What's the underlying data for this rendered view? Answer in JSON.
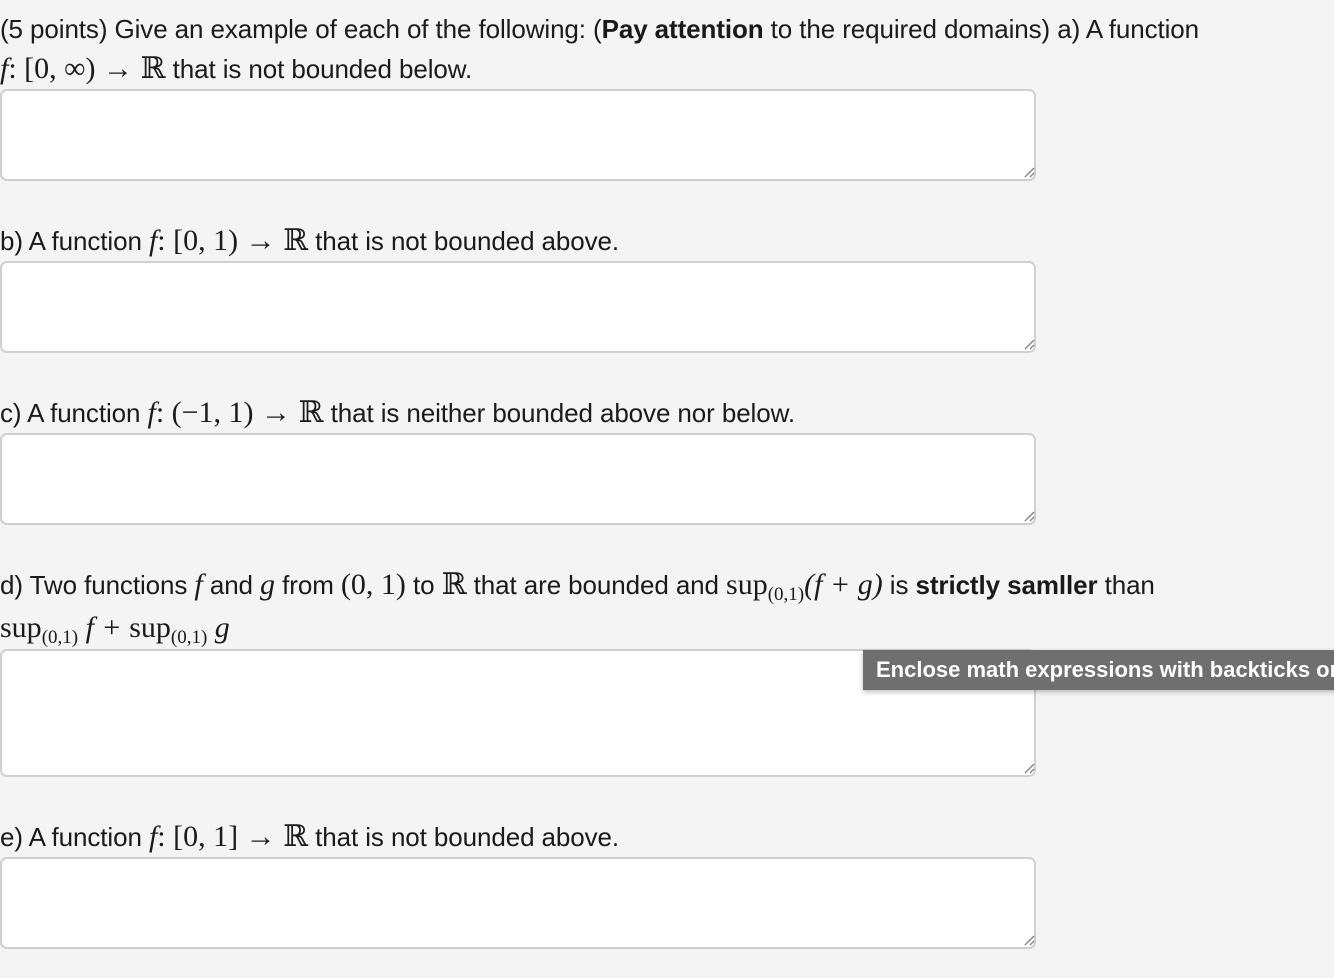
{
  "question_a": {
    "prefix": "(5 points) Give an example of each of the following: (",
    "bold": "Pay attention",
    "suffix": " to the required domains) a) A function",
    "math_f": "f",
    "math_domain": ": [0, ∞) → ℝ",
    "tail": " that is not bounded below."
  },
  "question_b": {
    "prefix": "b) A function ",
    "math_f": "f",
    "math_domain": ": [0, 1) → ℝ",
    "tail": " that is not bounded above."
  },
  "question_c": {
    "prefix": "c) A function ",
    "math_f": "f",
    "math_domain": ": (−1, 1) → ℝ",
    "tail": " that is neither bounded above nor below."
  },
  "question_d": {
    "prefix": "d) Two functions ",
    "math_f": "f",
    "and": " and ",
    "math_g": "g",
    "from": " from ",
    "math_interval": "(0, 1)",
    "to": " to ",
    "math_R": "ℝ",
    "mid": " that are bounded and ",
    "sup": "sup",
    "sub": "(0,1)",
    "math_fg": "(f + g)",
    "is": " is ",
    "bold": "strictly samller",
    "than": " than",
    "line2_sup1": "sup",
    "line2_sub1": "(0,1)",
    "line2_f": " f + ",
    "line2_sup2": "sup",
    "line2_sub2": "(0,1)",
    "line2_g": " g"
  },
  "question_e": {
    "prefix": "e) A function ",
    "math_f": "f",
    "math_domain": ": [0, 1] → ℝ",
    "tail": " that is not bounded above."
  },
  "answers": {
    "a": "",
    "b": "",
    "c": "",
    "d": "",
    "e": ""
  },
  "tooltip": {
    "text": "Enclose math expressions with backticks or"
  }
}
